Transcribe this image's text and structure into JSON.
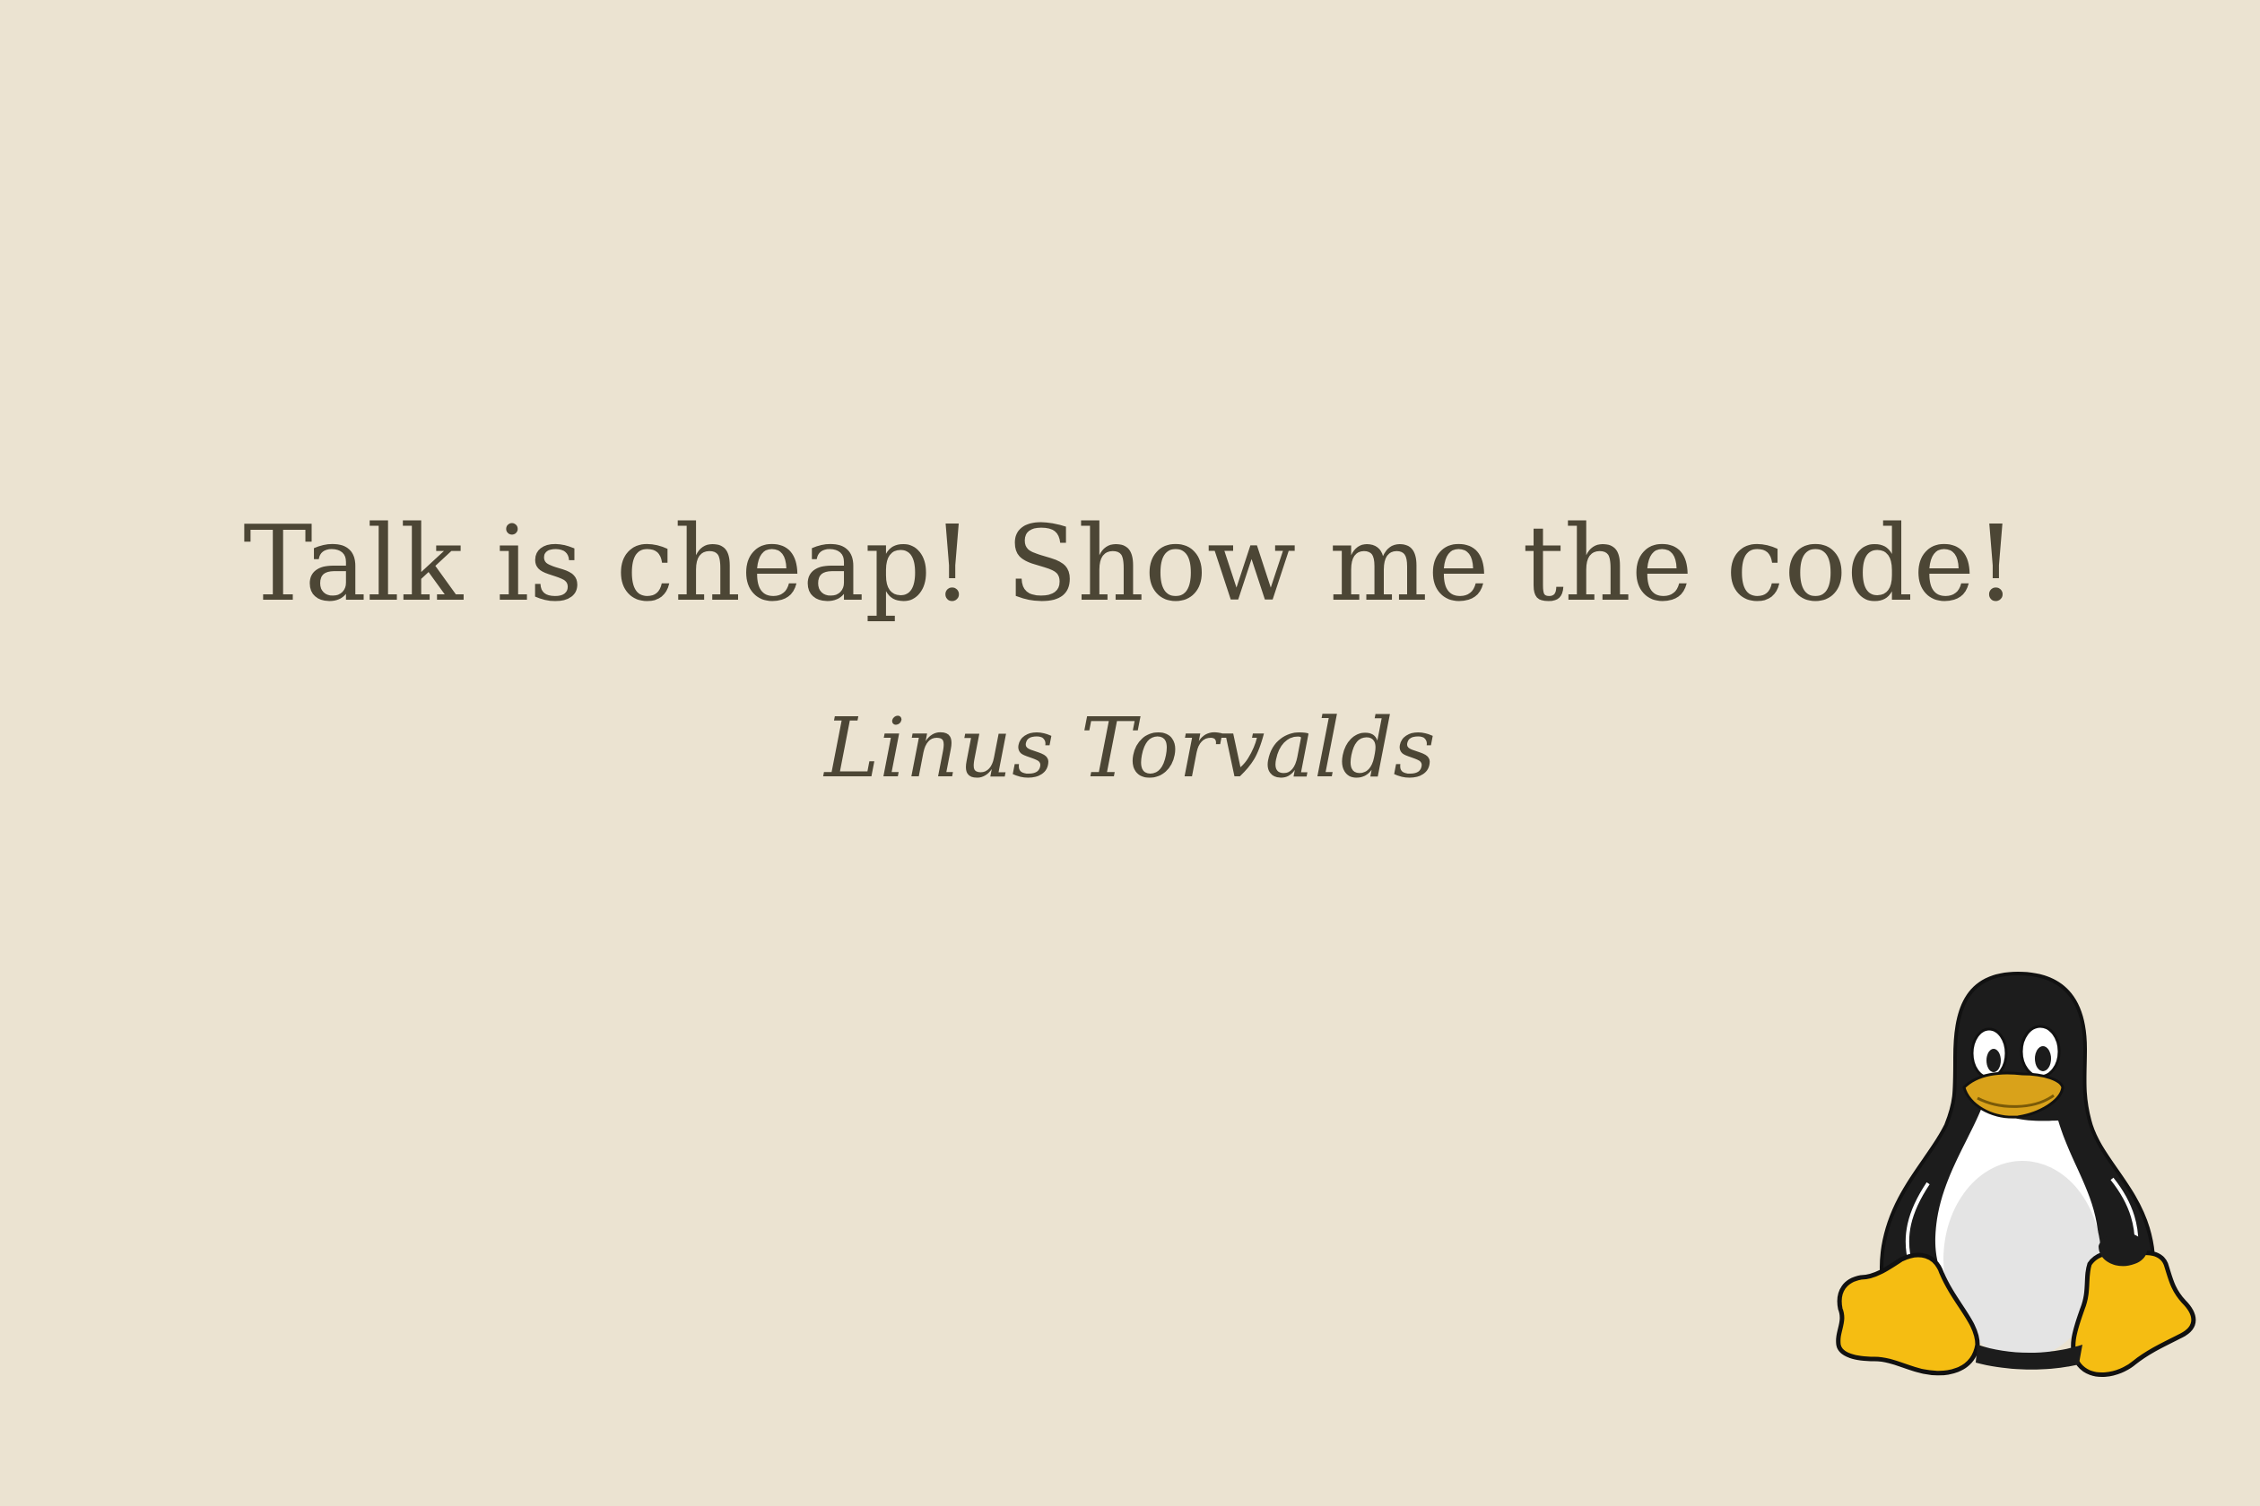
{
  "quote": {
    "text": "Talk is cheap! Show me the code!"
  },
  "author": {
    "name": "Linus Torvalds"
  },
  "mascot": {
    "icon": "tux-penguin-icon"
  },
  "colors": {
    "background": "#ebe3d1",
    "text": "#4c4635",
    "penguin_black": "#1c1c1c",
    "penguin_belly": "#e4e4e4",
    "penguin_yellow": "#f5bd12",
    "penguin_beak": "#d9a21a"
  }
}
